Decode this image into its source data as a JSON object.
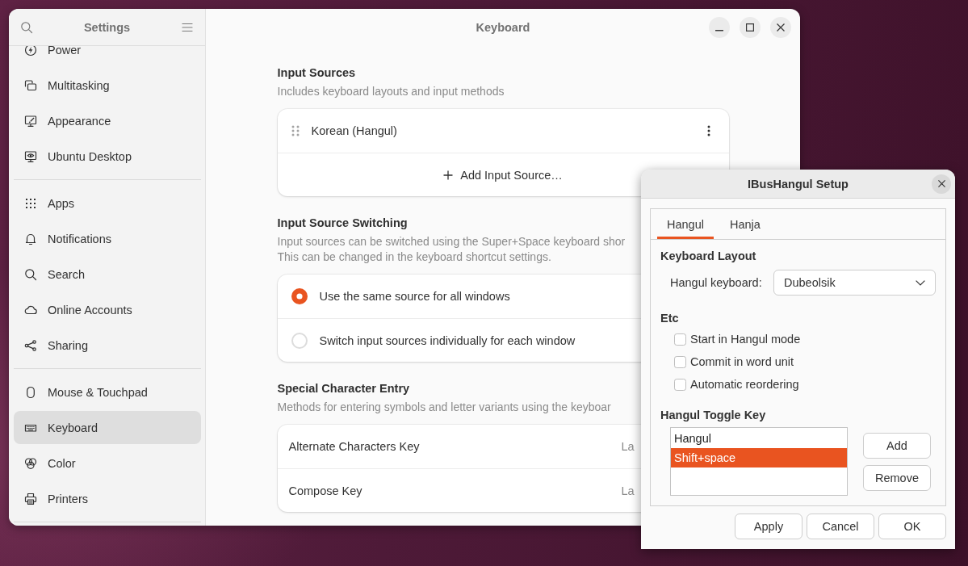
{
  "settings_window": {
    "sidebar": {
      "title": "Settings",
      "groups": [
        {
          "items": [
            {
              "label": "Power",
              "selected": false
            },
            {
              "label": "Multitasking",
              "selected": false
            },
            {
              "label": "Appearance",
              "selected": false
            },
            {
              "label": "Ubuntu Desktop",
              "selected": false
            }
          ]
        },
        {
          "items": [
            {
              "label": "Apps",
              "selected": false
            },
            {
              "label": "Notifications",
              "selected": false
            },
            {
              "label": "Search",
              "selected": false
            },
            {
              "label": "Online Accounts",
              "selected": false
            },
            {
              "label": "Sharing",
              "selected": false
            }
          ]
        },
        {
          "items": [
            {
              "label": "Mouse & Touchpad",
              "selected": false
            },
            {
              "label": "Keyboard",
              "selected": true
            },
            {
              "label": "Color",
              "selected": false
            },
            {
              "label": "Printers",
              "selected": false
            }
          ]
        }
      ]
    },
    "title": "Keyboard",
    "input_sources": {
      "heading": "Input Sources",
      "description": "Includes keyboard layouts and input methods",
      "sources": [
        {
          "name": "Korean (Hangul)"
        }
      ],
      "add_label": "Add Input Source…"
    },
    "input_source_switching": {
      "heading": "Input Source Switching",
      "description_lines": [
        "Input sources can be switched using the Super+Space keyboard shor",
        "This can be changed in the keyboard shortcut settings."
      ],
      "options": [
        {
          "label": "Use the same source for all windows",
          "selected": true
        },
        {
          "label": "Switch input sources individually for each window",
          "selected": false
        }
      ]
    },
    "special_character_entry": {
      "heading": "Special Character Entry",
      "description": "Methods for entering symbols and letter variants using the keyboar",
      "rows": [
        {
          "label": "Alternate Characters Key",
          "value": "La"
        },
        {
          "label": "Compose Key",
          "value": "La"
        }
      ]
    }
  },
  "setup_dialog": {
    "title": "IBusHangul Setup",
    "tabs": [
      {
        "label": "Hangul",
        "selected": true
      },
      {
        "label": "Hanja",
        "selected": false
      }
    ],
    "keyboard_layout": {
      "heading": "Keyboard Layout",
      "label": "Hangul keyboard:",
      "value": "Dubeolsik"
    },
    "etc": {
      "heading": "Etc",
      "options": [
        {
          "label": "Start in Hangul mode",
          "checked": false
        },
        {
          "label": "Commit in word unit",
          "checked": false
        },
        {
          "label": "Automatic reordering",
          "checked": false
        }
      ]
    },
    "toggle_key": {
      "heading": "Hangul Toggle Key",
      "keys": [
        {
          "label": "Hangul",
          "selected": false
        },
        {
          "label": "Shift+space",
          "selected": true
        }
      ],
      "buttons": [
        "Add",
        "Remove"
      ]
    },
    "buttons": [
      "Apply",
      "Cancel",
      "OK"
    ]
  }
}
